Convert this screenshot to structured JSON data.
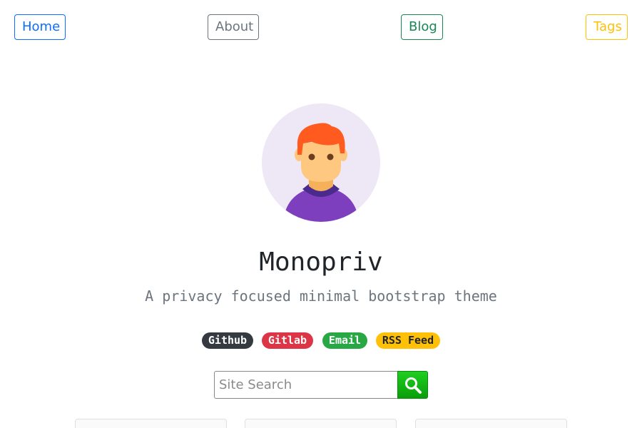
{
  "nav": {
    "home": "Home",
    "about": "About",
    "blog": "Blog",
    "tags": "Tags"
  },
  "profile": {
    "title": "Monopriv",
    "subtitle": "A privacy focused minimal bootstrap theme"
  },
  "badges": {
    "github": "Github",
    "gitlab": "Gitlab",
    "email": "Email",
    "rss": "RSS Feed"
  },
  "search": {
    "placeholder": "Site Search",
    "value": ""
  },
  "icons": {
    "avatar": "avatar-person-icon",
    "search": "search-icon"
  },
  "colors": {
    "primary": "#0d6efd",
    "secondary": "#6c757d",
    "success": "#198754",
    "warning": "#ffc107",
    "danger": "#dc3545",
    "dark": "#343a40",
    "search_button": "#14b814"
  }
}
